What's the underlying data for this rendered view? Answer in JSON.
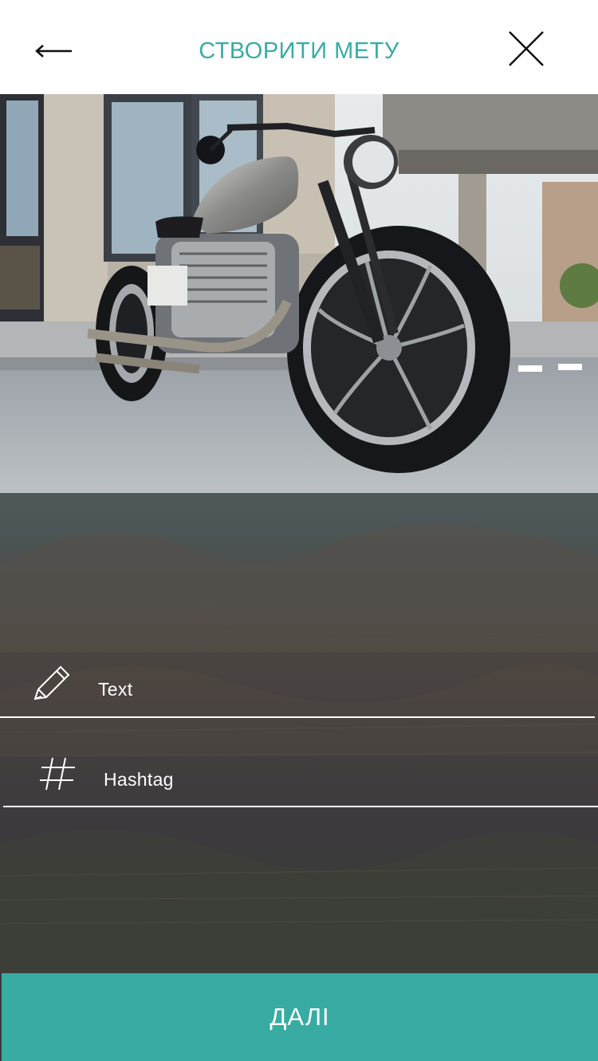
{
  "header": {
    "title": "СТВОРИТИ МЕТУ"
  },
  "icons": {
    "back": "arrow-left-icon",
    "close": "close-icon",
    "text_field": "pencil-icon",
    "hashtag_field": "hashtag-icon"
  },
  "form": {
    "text_label": "Text",
    "hashtag_label": "Hashtag"
  },
  "footer": {
    "next_label": "ДАЛІ"
  },
  "colors": {
    "accent": "#38aca2",
    "header_bg": "#ffffff",
    "overlay": "#3c3b40"
  }
}
